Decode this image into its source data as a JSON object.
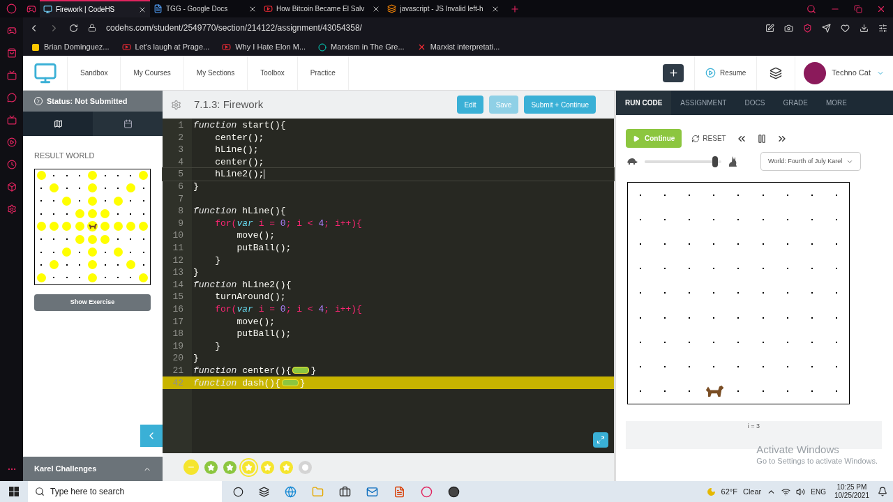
{
  "browser": {
    "tabs": [
      {
        "title": "Firework | CodeHS",
        "selected": true,
        "kind": "monitor"
      },
      {
        "title": "TGG - Google Docs",
        "selected": false,
        "kind": "doc"
      },
      {
        "title": "How Bitcoin Became El Salv",
        "selected": false,
        "kind": "video"
      },
      {
        "title": "javascript - JS Invalid left-h",
        "selected": false,
        "kind": "stack"
      }
    ],
    "address": "codehs.com/student/2549770/section/214122/assignment/43054358/",
    "bookmarks": [
      {
        "label": "Brian Dominguez...",
        "kind": "note"
      },
      {
        "label": "Let's laugh at Prage...",
        "kind": "video"
      },
      {
        "label": "Why I Hate Elon M...",
        "kind": "video"
      },
      {
        "label": "Marxism in The Gre...",
        "kind": "ring"
      },
      {
        "label": "Marxist interpretati...",
        "kind": "cross"
      }
    ]
  },
  "header": {
    "nav": [
      "Sandbox",
      "My Courses",
      "My Sections",
      "Toolbox",
      "Practice"
    ],
    "resume": "Resume",
    "user": "Techno Cat"
  },
  "left_panel": {
    "status": "Status: Not Submitted",
    "tabs": [
      {
        "kind": "map",
        "selected": true
      },
      {
        "kind": "calendar",
        "selected": false
      }
    ],
    "result_world": {
      "title": "RESULT WORLD",
      "rows": [
        {
          "cells": [
            {
              "ball": true,
              "karel": false
            },
            {
              "ball": false,
              "karel": false
            },
            {
              "ball": false,
              "karel": false
            },
            {
              "ball": false,
              "karel": false
            },
            {
              "ball": true,
              "karel": false
            },
            {
              "ball": false,
              "karel": false
            },
            {
              "ball": false,
              "karel": false
            },
            {
              "ball": false,
              "karel": false
            },
            {
              "ball": true,
              "karel": false
            }
          ]
        },
        {
          "cells": [
            {
              "ball": false,
              "karel": false
            },
            {
              "ball": true,
              "karel": false
            },
            {
              "ball": false,
              "karel": false
            },
            {
              "ball": false,
              "karel": false
            },
            {
              "ball": true,
              "karel": false
            },
            {
              "ball": false,
              "karel": false
            },
            {
              "ball": false,
              "karel": false
            },
            {
              "ball": true,
              "karel": false
            },
            {
              "ball": false,
              "karel": false
            }
          ]
        },
        {
          "cells": [
            {
              "ball": false,
              "karel": false
            },
            {
              "ball": false,
              "karel": false
            },
            {
              "ball": true,
              "karel": false
            },
            {
              "ball": false,
              "karel": false
            },
            {
              "ball": true,
              "karel": false
            },
            {
              "ball": false,
              "karel": false
            },
            {
              "ball": true,
              "karel": false
            },
            {
              "ball": false,
              "karel": false
            },
            {
              "ball": false,
              "karel": false
            }
          ]
        },
        {
          "cells": [
            {
              "ball": false,
              "karel": false
            },
            {
              "ball": false,
              "karel": false
            },
            {
              "ball": false,
              "karel": false
            },
            {
              "ball": true,
              "karel": false
            },
            {
              "ball": true,
              "karel": false
            },
            {
              "ball": true,
              "karel": false
            },
            {
              "ball": false,
              "karel": false
            },
            {
              "ball": false,
              "karel": false
            },
            {
              "ball": false,
              "karel": false
            }
          ]
        },
        {
          "cells": [
            {
              "ball": true,
              "karel": false
            },
            {
              "ball": true,
              "karel": false
            },
            {
              "ball": true,
              "karel": false
            },
            {
              "ball": true,
              "karel": false
            },
            {
              "ball": true,
              "karel": true
            },
            {
              "ball": true,
              "karel": false
            },
            {
              "ball": true,
              "karel": false
            },
            {
              "ball": true,
              "karel": false
            },
            {
              "ball": true,
              "karel": false
            }
          ]
        },
        {
          "cells": [
            {
              "ball": false,
              "karel": false
            },
            {
              "ball": false,
              "karel": false
            },
            {
              "ball": false,
              "karel": false
            },
            {
              "ball": true,
              "karel": false
            },
            {
              "ball": true,
              "karel": false
            },
            {
              "ball": true,
              "karel": false
            },
            {
              "ball": false,
              "karel": false
            },
            {
              "ball": false,
              "karel": false
            },
            {
              "ball": false,
              "karel": false
            }
          ]
        },
        {
          "cells": [
            {
              "ball": false,
              "karel": false
            },
            {
              "ball": false,
              "karel": false
            },
            {
              "ball": true,
              "karel": false
            },
            {
              "ball": false,
              "karel": false
            },
            {
              "ball": true,
              "karel": false
            },
            {
              "ball": false,
              "karel": false
            },
            {
              "ball": true,
              "karel": false
            },
            {
              "ball": false,
              "karel": false
            },
            {
              "ball": false,
              "karel": false
            }
          ]
        },
        {
          "cells": [
            {
              "ball": false,
              "karel": false
            },
            {
              "ball": true,
              "karel": false
            },
            {
              "ball": false,
              "karel": false
            },
            {
              "ball": false,
              "karel": false
            },
            {
              "ball": true,
              "karel": false
            },
            {
              "ball": false,
              "karel": false
            },
            {
              "ball": false,
              "karel": false
            },
            {
              "ball": true,
              "karel": false
            },
            {
              "ball": false,
              "karel": false
            }
          ]
        },
        {
          "cells": [
            {
              "ball": true,
              "karel": false
            },
            {
              "ball": false,
              "karel": false
            },
            {
              "ball": false,
              "karel": false
            },
            {
              "ball": false,
              "karel": false
            },
            {
              "ball": true,
              "karel": false
            },
            {
              "ball": false,
              "karel": false
            },
            {
              "ball": false,
              "karel": false
            },
            {
              "ball": false,
              "karel": false
            },
            {
              "ball": true,
              "karel": false
            }
          ]
        }
      ]
    },
    "show_exercise": "Show Exercise",
    "challenges": "Karel Challenges"
  },
  "editor": {
    "title": "7.1.3: Firework",
    "buttons": [
      {
        "label": "Edit",
        "kind": "primary"
      },
      {
        "label": "Save",
        "kind": "muted"
      },
      {
        "label": "Submit + Continue",
        "kind": "primary"
      }
    ],
    "lines": [
      {
        "number": "1",
        "active": false,
        "highlighted": false,
        "tokens": [
          {
            "kind": "decl",
            "text": "function"
          },
          {
            "kind": "text",
            "text": " start(){"
          }
        ]
      },
      {
        "number": "2",
        "active": false,
        "highlighted": false,
        "tokens": [
          {
            "kind": "text",
            "text": "    center();"
          }
        ]
      },
      {
        "number": "3",
        "active": false,
        "highlighted": false,
        "tokens": [
          {
            "kind": "text",
            "text": "    hLine();"
          }
        ]
      },
      {
        "number": "4",
        "active": false,
        "highlighted": false,
        "tokens": [
          {
            "kind": "text",
            "text": "    center();"
          }
        ]
      },
      {
        "number": "5",
        "active": true,
        "highlighted": false,
        "tokens": [
          {
            "kind": "text",
            "text": "    hLine2();"
          }
        ]
      },
      {
        "number": "6",
        "active": false,
        "highlighted": false,
        "tokens": [
          {
            "kind": "text",
            "text": "}"
          }
        ]
      },
      {
        "number": "7",
        "active": false,
        "highlighted": false
      },
      {
        "number": "8",
        "active": false,
        "highlighted": false,
        "tokens": [
          {
            "kind": "decl",
            "text": "function"
          },
          {
            "kind": "text",
            "text": " hLine(){"
          }
        ]
      },
      {
        "number": "9",
        "active": false,
        "highlighted": false,
        "tokens": [
          {
            "kind": "control",
            "text": "    for("
          },
          {
            "kind": "var",
            "text": "var"
          },
          {
            "kind": "control",
            "text": " i = "
          },
          {
            "kind": "num",
            "text": "0"
          },
          {
            "kind": "control",
            "text": "; i < "
          },
          {
            "kind": "num",
            "text": "4"
          },
          {
            "kind": "control",
            "text": "; i++){"
          }
        ]
      },
      {
        "number": "10",
        "active": false,
        "highlighted": false,
        "tokens": [
          {
            "kind": "text",
            "text": "        move();"
          }
        ]
      },
      {
        "number": "11",
        "active": false,
        "highlighted": false,
        "tokens": [
          {
            "kind": "text",
            "text": "        putBall();"
          }
        ]
      },
      {
        "number": "12",
        "active": false,
        "highlighted": false,
        "tokens": [
          {
            "kind": "text",
            "text": "    }"
          }
        ]
      },
      {
        "number": "13",
        "active": false,
        "highlighted": false,
        "tokens": [
          {
            "kind": "text",
            "text": "}"
          }
        ]
      },
      {
        "number": "14",
        "active": false,
        "highlighted": false,
        "tokens": [
          {
            "kind": "decl",
            "text": "function"
          },
          {
            "kind": "text",
            "text": " hLine2(){"
          }
        ]
      },
      {
        "number": "15",
        "active": false,
        "highlighted": false,
        "tokens": [
          {
            "kind": "text",
            "text": "    turnAround();"
          }
        ]
      },
      {
        "number": "16",
        "active": false,
        "highlighted": false,
        "tokens": [
          {
            "kind": "control",
            "text": "    for("
          },
          {
            "kind": "var",
            "text": "var"
          },
          {
            "kind": "control",
            "text": " i = "
          },
          {
            "kind": "num",
            "text": "0"
          },
          {
            "kind": "control",
            "text": "; i < "
          },
          {
            "kind": "num",
            "text": "4"
          },
          {
            "kind": "control",
            "text": "; i++){"
          }
        ]
      },
      {
        "number": "17",
        "active": false,
        "highlighted": false,
        "tokens": [
          {
            "kind": "text",
            "text": "        move();"
          }
        ]
      },
      {
        "number": "18",
        "active": false,
        "highlighted": false,
        "tokens": [
          {
            "kind": "text",
            "text": "        putBall();"
          }
        ]
      },
      {
        "number": "19",
        "active": false,
        "highlighted": false,
        "tokens": [
          {
            "kind": "text",
            "text": "    }"
          }
        ]
      },
      {
        "number": "20",
        "active": false,
        "highlighted": false,
        "tokens": [
          {
            "kind": "text",
            "text": "}"
          }
        ]
      },
      {
        "number": "21",
        "active": false,
        "highlighted": false,
        "tokens": [
          {
            "kind": "decl",
            "text": "function"
          },
          {
            "kind": "text",
            "text": " center(){"
          },
          {
            "kind": "fold"
          },
          {
            "kind": "text",
            "text": "}"
          }
        ]
      },
      {
        "number": "42",
        "active": false,
        "highlighted": true,
        "tokens": [
          {
            "kind": "decl",
            "text": "function"
          },
          {
            "kind": "text",
            "text": " dash(){"
          },
          {
            "kind": "fold"
          },
          {
            "kind": "text",
            "text": "}"
          }
        ]
      }
    ],
    "badges": [
      {
        "kind": "minus",
        "color": "#f5e52e",
        "selected": false
      },
      {
        "kind": "star",
        "color": "#8cc63f",
        "selected": false
      },
      {
        "kind": "star",
        "color": "#8cc63f",
        "selected": false
      },
      {
        "kind": "star",
        "color": "#f5e52e",
        "selected": true
      },
      {
        "kind": "star",
        "color": "#f5e52e",
        "selected": false
      },
      {
        "kind": "star",
        "color": "#f5e52e",
        "selected": false
      },
      {
        "kind": "dot",
        "color": "#d4d4d4",
        "selected": false
      }
    ]
  },
  "right_panel": {
    "tabs": [
      {
        "label": "RUN CODE",
        "selected": true
      },
      {
        "label": "ASSIGNMENT",
        "selected": false
      },
      {
        "label": "DOCS",
        "selected": false
      },
      {
        "label": "GRADE",
        "selected": false
      },
      {
        "label": "MORE",
        "selected": false
      }
    ],
    "continue": "Continue",
    "reset": "RESET",
    "speed": {
      "level": 0.95
    },
    "world_select": "World: Fourth of July Karel",
    "world": {
      "rows": [
        {
          "cells": [
            {
              "karel": false
            },
            {
              "karel": false
            },
            {
              "karel": false
            },
            {
              "karel": false
            },
            {
              "karel": false
            },
            {
              "karel": false
            },
            {
              "karel": false
            },
            {
              "karel": false
            },
            {
              "karel": false
            }
          ]
        },
        {
          "cells": [
            {
              "karel": false
            },
            {
              "karel": false
            },
            {
              "karel": false
            },
            {
              "karel": false
            },
            {
              "karel": false
            },
            {
              "karel": false
            },
            {
              "karel": false
            },
            {
              "karel": false
            },
            {
              "karel": false
            }
          ]
        },
        {
          "cells": [
            {
              "karel": false
            },
            {
              "karel": false
            },
            {
              "karel": false
            },
            {
              "karel": false
            },
            {
              "karel": false
            },
            {
              "karel": false
            },
            {
              "karel": false
            },
            {
              "karel": false
            },
            {
              "karel": false
            }
          ]
        },
        {
          "cells": [
            {
              "karel": false
            },
            {
              "karel": false
            },
            {
              "karel": false
            },
            {
              "karel": false
            },
            {
              "karel": false
            },
            {
              "karel": false
            },
            {
              "karel": false
            },
            {
              "karel": false
            },
            {
              "karel": false
            }
          ]
        },
        {
          "cells": [
            {
              "karel": false
            },
            {
              "karel": false
            },
            {
              "karel": false
            },
            {
              "karel": false
            },
            {
              "karel": false
            },
            {
              "karel": false
            },
            {
              "karel": false
            },
            {
              "karel": false
            },
            {
              "karel": false
            }
          ]
        },
        {
          "cells": [
            {
              "karel": false
            },
            {
              "karel": false
            },
            {
              "karel": false
            },
            {
              "karel": false
            },
            {
              "karel": false
            },
            {
              "karel": false
            },
            {
              "karel": false
            },
            {
              "karel": false
            },
            {
              "karel": false
            }
          ]
        },
        {
          "cells": [
            {
              "karel": false
            },
            {
              "karel": false
            },
            {
              "karel": false
            },
            {
              "karel": false
            },
            {
              "karel": false
            },
            {
              "karel": false
            },
            {
              "karel": false
            },
            {
              "karel": false
            },
            {
              "karel": false
            }
          ]
        },
        {
          "cells": [
            {
              "karel": false
            },
            {
              "karel": false
            },
            {
              "karel": false
            },
            {
              "karel": false
            },
            {
              "karel": false
            },
            {
              "karel": false
            },
            {
              "karel": false
            },
            {
              "karel": false
            },
            {
              "karel": false
            }
          ]
        },
        {
          "cells": [
            {
              "karel": false
            },
            {
              "karel": false
            },
            {
              "karel": false
            },
            {
              "karel": true
            },
            {
              "karel": false
            },
            {
              "karel": false
            },
            {
              "karel": false
            },
            {
              "karel": false
            },
            {
              "karel": false
            }
          ]
        }
      ]
    },
    "output": "i = 3"
  },
  "overlay": {
    "title": "Activate Windows",
    "subtitle": "Go to Settings to activate Windows."
  },
  "taskbar": {
    "search_placeholder": "Type here to search",
    "temperature": "62°F",
    "weather": "Clear",
    "language": "ENG",
    "time": "10:25 PM",
    "date": "10/25/2021"
  }
}
